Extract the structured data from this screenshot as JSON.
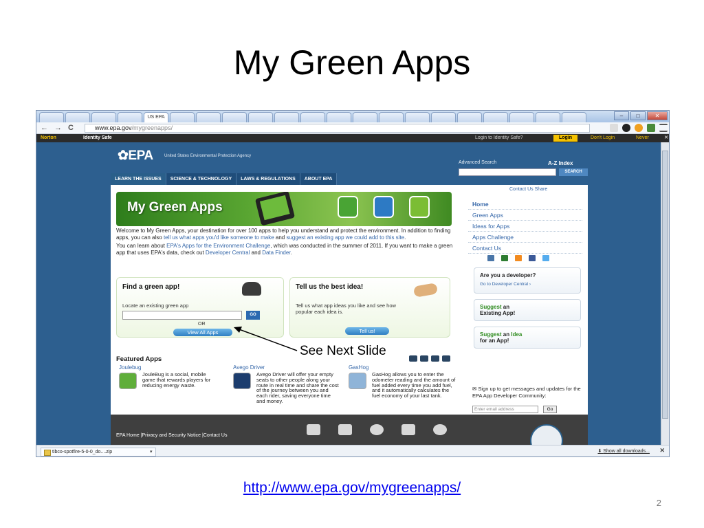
{
  "slide": {
    "title": "My Green Apps",
    "annotation": "See Next Slide",
    "link": "http://www.epa.gov/mygreenapps/",
    "page_number": "2"
  },
  "browser": {
    "active_tab_label": "US EPA",
    "url_host": "www.epa.gov",
    "url_path": "/mygreenapps/",
    "nav_back": "←",
    "nav_forward": "→",
    "nav_reload": "C",
    "window_min": "–",
    "window_max": "□",
    "window_close": "✕"
  },
  "norton": {
    "brand": "Norton",
    "product": "Identity Safe",
    "prompt": "Login to Identity Safe?",
    "login": "Login",
    "dont_login": "Don't Login",
    "never": "Never",
    "close": "✕"
  },
  "epa": {
    "logo": "EPA",
    "agency": "United States Environmental Protection Agency",
    "advanced_search": "Advanced Search",
    "az_index": "A-Z Index",
    "search_button": "SEARCH",
    "nav": [
      "LEARN THE ISSUES",
      "SCIENCE & TECHNOLOGY",
      "LAWS & REGULATIONS",
      "ABOUT EPA"
    ],
    "contact_share": "Contact Us   Share"
  },
  "banner": {
    "title": "My Green Apps"
  },
  "welcome": {
    "p1_a": "Welcome to My Green Apps, your destination for over 100 apps to help you understand and protect the environment. In addition to finding apps, you can also ",
    "p1_link1": "tell us what apps you'd like someone to make",
    "p1_b": " and ",
    "p1_link2": "suggest an existing app we could add to this site",
    "p1_c": ".",
    "p2_a": "You can learn about ",
    "p2_link1": "EPA's Apps for the Environment Challenge",
    "p2_b": ", which was conducted in the summer of 2011. If you want to make a green app that uses EPA's data, check out ",
    "p2_link2": "Developer Central",
    "p2_c": " and ",
    "p2_link3": "Data Finder",
    "p2_d": "."
  },
  "find_box": {
    "title": "Find a green app!",
    "label": "Locate an existing green app",
    "go": "GO",
    "or": "OR",
    "view_all": "View All Apps"
  },
  "tell_box": {
    "title": "Tell us the best idea!",
    "text": "Tell us what app ideas you like and see how popular each idea is.",
    "button": "Tell us!"
  },
  "featured": {
    "title": "Featured Apps",
    "apps": [
      {
        "name": "Joulebug",
        "desc": "JouleBug is a social, mobile game that rewards players for reducing energy waste.",
        "color": "#5fae3a"
      },
      {
        "name": "Avego Driver",
        "desc": "Avego Driver will offer your empty seats to other people along your route in real time and share the cost of the journey between you and each rider, saving everyone time and money.",
        "color": "#1c3d6e"
      },
      {
        "name": "GasHog",
        "desc": "GasHog allows you to enter the odometer reading and the amount of fuel added every time you add fuel, and it automatically calculates the fuel economy of your last tank.",
        "color": "#8fb4d8"
      }
    ]
  },
  "right_nav": {
    "items": [
      "Home",
      "Green Apps",
      "Ideas for Apps",
      "Apps Challenge",
      "Contact Us"
    ],
    "developer_title": "Are you a developer?",
    "developer_link": "Go to Developer Central ›",
    "suggest_existing_a": "Suggest",
    "suggest_existing_b": " an",
    "suggest_existing_c": "Existing App!",
    "suggest_idea_a": "Suggest",
    "suggest_idea_b": " an ",
    "suggest_idea_c": "Idea",
    "suggest_idea_d": "for an App!",
    "signup_text": "Sign up to get messages and updates for the EPA App Developer Community:",
    "email_placeholder": "Enter email address",
    "signup_go": "Go"
  },
  "footer": {
    "links": "EPA Home  |Privacy and Security Notice  |Contact Us"
  },
  "download_bar": {
    "file": "tibco-spotfire-5-0-0_do....zip",
    "show_all": "Show all downloads...",
    "close": "✕"
  },
  "colors": {
    "epa_blue": "#2d5f8f",
    "nav_dark": "#1f4d7a",
    "link": "#3466a8",
    "green": "#2e8b1e"
  }
}
